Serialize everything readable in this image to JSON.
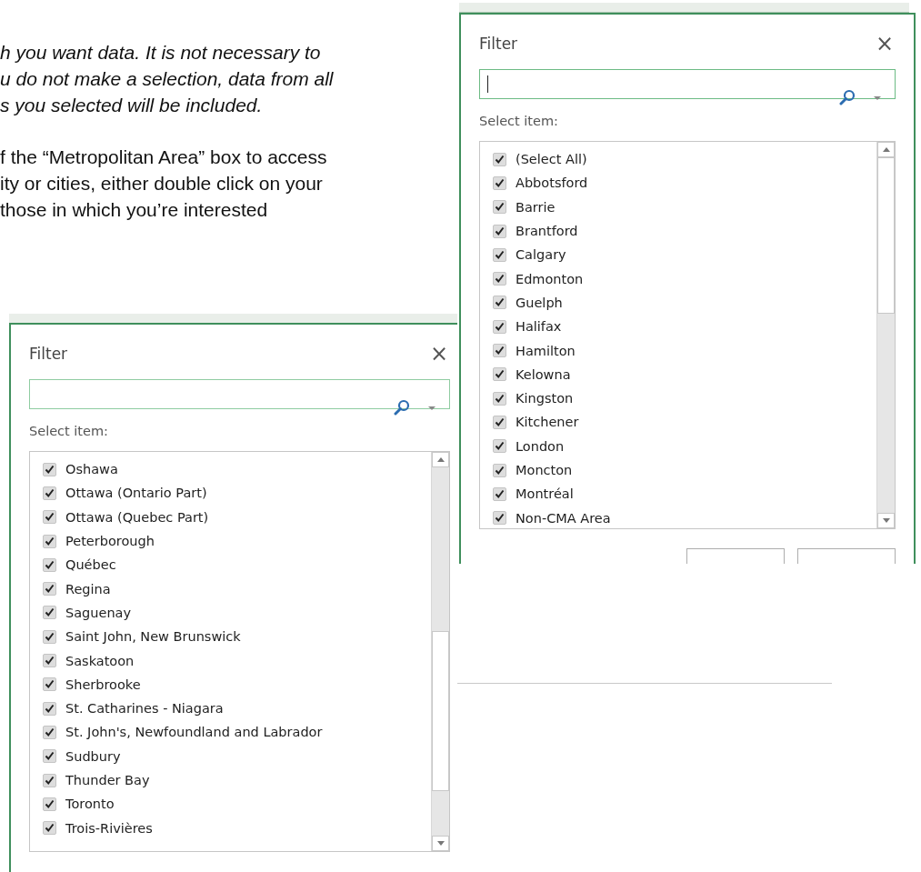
{
  "instructions": [
    {
      "kind": "italic",
      "lines": [
        "h you want data. It is not necessary to",
        "u do not make a selection, data from all",
        "s you selected will be included."
      ]
    },
    {
      "kind": "regular",
      "lines": [
        "f the “Metropolitan Area” box to access",
        "ity or cities, either double click on your",
        "those in which you’re interested"
      ]
    }
  ],
  "dialogs": [
    {
      "title": "Filter",
      "close": "×",
      "search": {
        "focused": true
      },
      "list_label": "Select item:",
      "show_buttons": true,
      "items": [
        {
          "label": "(Select All)",
          "checked": true
        },
        {
          "label": "Abbotsford",
          "checked": true
        },
        {
          "label": "Barrie",
          "checked": true
        },
        {
          "label": "Brantford",
          "checked": true
        },
        {
          "label": "Calgary",
          "checked": true
        },
        {
          "label": "Edmonton",
          "checked": true
        },
        {
          "label": "Guelph",
          "checked": true
        },
        {
          "label": "Halifax",
          "checked": true
        },
        {
          "label": "Hamilton",
          "checked": true
        },
        {
          "label": "Kelowna",
          "checked": true
        },
        {
          "label": "Kingston",
          "checked": true
        },
        {
          "label": "Kitchener",
          "checked": true
        },
        {
          "label": "London",
          "checked": true
        },
        {
          "label": "Moncton",
          "checked": true
        },
        {
          "label": "Montréal",
          "checked": true
        },
        {
          "label": "Non-CMA Area",
          "checked": true
        }
      ]
    },
    {
      "title": "Filter",
      "close": "×",
      "search": {
        "focused": false
      },
      "list_label": "Select item:",
      "show_buttons": false,
      "items": [
        {
          "label": "Oshawa",
          "checked": true
        },
        {
          "label": "Ottawa (Ontario Part)",
          "checked": true
        },
        {
          "label": "Ottawa (Quebec Part)",
          "checked": true
        },
        {
          "label": "Peterborough",
          "checked": true
        },
        {
          "label": "Québec",
          "checked": true
        },
        {
          "label": "Regina",
          "checked": true
        },
        {
          "label": "Saguenay",
          "checked": true
        },
        {
          "label": "Saint John, New Brunswick",
          "checked": true
        },
        {
          "label": "Saskatoon",
          "checked": true
        },
        {
          "label": "Sherbrooke",
          "checked": true
        },
        {
          "label": "St. Catharines - Niagara",
          "checked": true
        },
        {
          "label": "St. John's, Newfoundland and Labrador",
          "checked": true
        },
        {
          "label": "Sudbury",
          "checked": true
        },
        {
          "label": "Thunder Bay",
          "checked": true
        },
        {
          "label": "Toronto",
          "checked": true
        },
        {
          "label": "Trois-Rivières",
          "checked": true
        }
      ]
    }
  ]
}
